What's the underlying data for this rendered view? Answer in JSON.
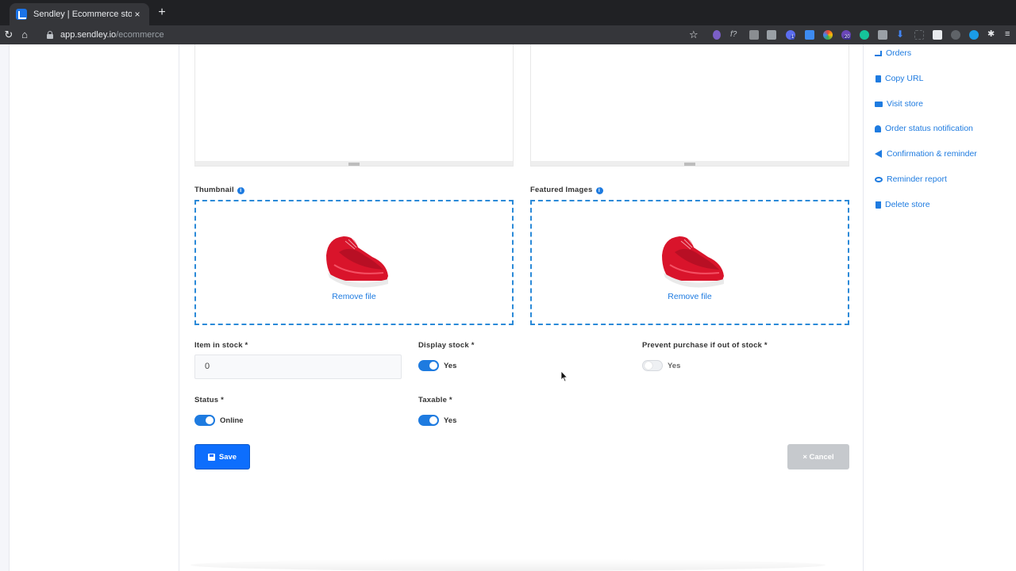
{
  "browser": {
    "tab_title": "Sendley | Ecommerce store",
    "tab_close": "×",
    "new_tab": "+",
    "url_host": "app.sendley.io",
    "url_path": "/ecommerce",
    "extension_badges": [
      "1",
      "20"
    ]
  },
  "form": {
    "thumbnail_label": "Thumbnail",
    "featured_label": "Featured Images",
    "remove_file": "Remove file",
    "stock_label": "Item in stock *",
    "stock_value": "0",
    "display_stock_label": "Display stock *",
    "display_stock_value": "Yes",
    "display_stock_on": true,
    "prevent_label": "Prevent purchase if out of stock *",
    "prevent_value": "Yes",
    "prevent_on": false,
    "status_label": "Status *",
    "status_value": "Online",
    "status_on": true,
    "taxable_label": "Taxable *",
    "taxable_value": "Yes",
    "taxable_on": true,
    "save_label": "Save",
    "cancel_label": "× Cancel"
  },
  "sidebar": {
    "items": [
      {
        "label": "Orders",
        "icon": "cart-icon"
      },
      {
        "label": "Copy URL",
        "icon": "copy-icon"
      },
      {
        "label": "Visit store",
        "icon": "store-icon"
      },
      {
        "label": "Order status notification",
        "icon": "bell-icon"
      },
      {
        "label": "Confirmation & reminder",
        "icon": "megaphone-icon"
      },
      {
        "label": "Reminder report",
        "icon": "eye-icon"
      },
      {
        "label": "Delete store",
        "icon": "trash-icon"
      }
    ]
  },
  "colors": {
    "accent": "#1e7be0",
    "save": "#0d6efd",
    "cancel": "#c6c9cd",
    "dropzone_border": "#2b8ad8"
  }
}
